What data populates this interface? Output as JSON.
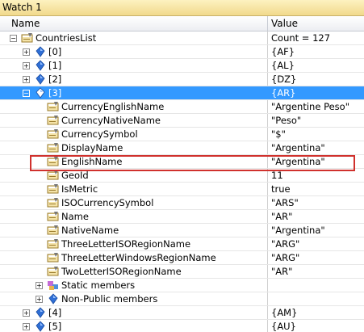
{
  "window": {
    "title": "Watch 1"
  },
  "columns": {
    "name": "Name",
    "value": "Value"
  },
  "rows": [
    {
      "name": "CountriesList",
      "value": "Count = 127",
      "expander": "minus",
      "icon": "property-icon"
    },
    {
      "name": "[0]",
      "value": "{AF}",
      "expander": "plus",
      "icon": "object-icon"
    },
    {
      "name": "[1]",
      "value": "{AL}",
      "expander": "plus",
      "icon": "object-icon"
    },
    {
      "name": "[2]",
      "value": "{DZ}",
      "expander": "plus",
      "icon": "object-icon"
    },
    {
      "name": "[3]",
      "value": "{AR}",
      "expander": "minus",
      "icon": "object-icon",
      "selected": true
    },
    {
      "name": "CurrencyEnglishName",
      "value": "\"Argentine Peso\"",
      "icon": "property-icon"
    },
    {
      "name": "CurrencyNativeName",
      "value": "\"Peso\"",
      "icon": "property-icon"
    },
    {
      "name": "CurrencySymbol",
      "value": "\"$\"",
      "icon": "property-icon"
    },
    {
      "name": "DisplayName",
      "value": "\"Argentina\"",
      "icon": "property-icon"
    },
    {
      "name": "EnglishName",
      "value": "\"Argentina\"",
      "icon": "property-icon"
    },
    {
      "name": "GeoId",
      "value": "11",
      "icon": "property-icon"
    },
    {
      "name": "IsMetric",
      "value": "true",
      "icon": "property-icon"
    },
    {
      "name": "ISOCurrencySymbol",
      "value": "\"ARS\"",
      "icon": "property-icon"
    },
    {
      "name": "Name",
      "value": "\"AR\"",
      "icon": "property-icon"
    },
    {
      "name": "NativeName",
      "value": "\"Argentina\"",
      "icon": "property-icon"
    },
    {
      "name": "ThreeLetterISORegionName",
      "value": "\"ARG\"",
      "icon": "property-icon"
    },
    {
      "name": "ThreeLetterWindowsRegionName",
      "value": "\"ARG\"",
      "icon": "property-icon"
    },
    {
      "name": "TwoLetterISORegionName",
      "value": "\"AR\"",
      "icon": "property-icon"
    },
    {
      "name": "Static members",
      "value": "",
      "expander": "plus",
      "icon": "static-members-icon"
    },
    {
      "name": "Non-Public members",
      "value": "",
      "expander": "plus",
      "icon": "object-icon"
    },
    {
      "name": "[4]",
      "value": "{AM}",
      "expander": "plus",
      "icon": "object-icon"
    },
    {
      "name": "[5]",
      "value": "{AU}",
      "expander": "plus",
      "icon": "object-icon"
    }
  ],
  "colors": {
    "selection": "#3399ff",
    "highlight_box": "#d0312d"
  }
}
